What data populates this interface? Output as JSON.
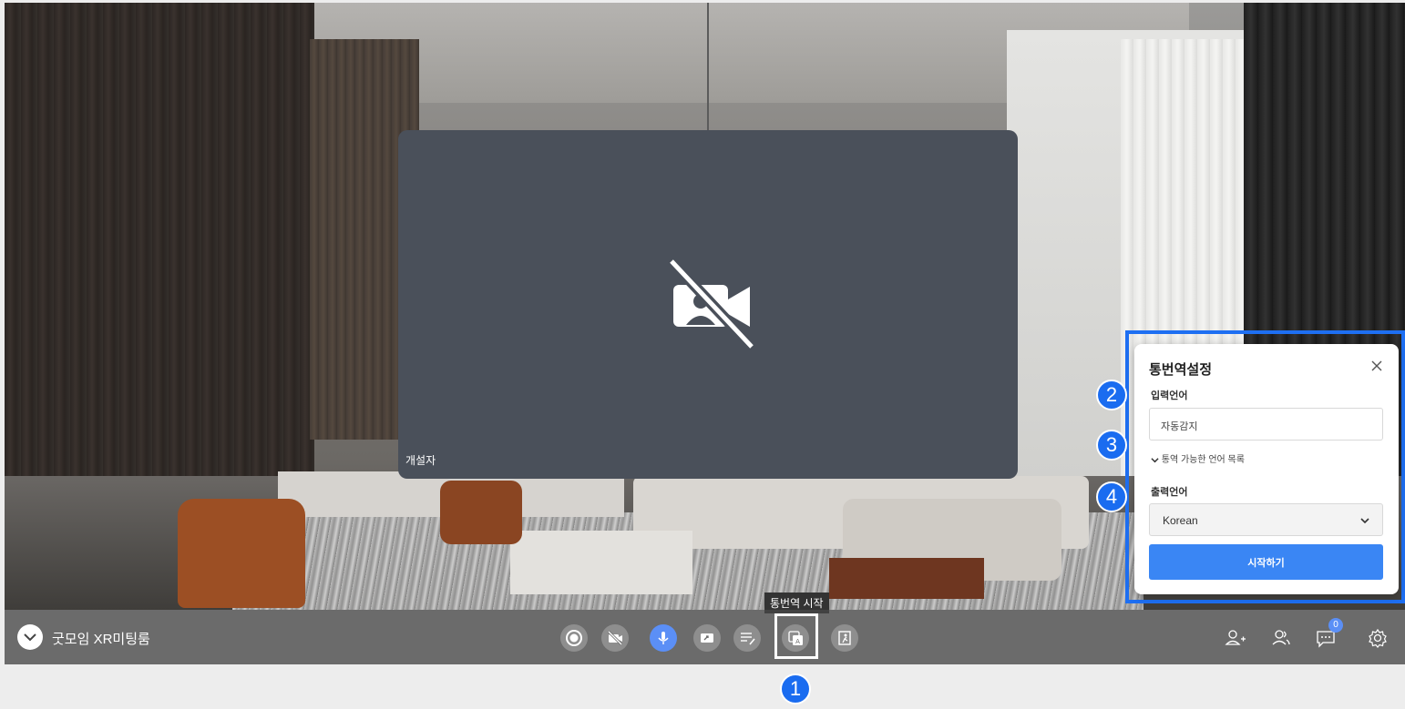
{
  "room": {
    "title": "굿모임 XR미팅룸"
  },
  "video_tile": {
    "host_label": "개설자",
    "icon": "camera-off-icon"
  },
  "toolbar": {
    "controls": [
      {
        "name": "record",
        "icon": "record-icon"
      },
      {
        "name": "camera-toggle",
        "icon": "camera-off-icon"
      },
      {
        "name": "mic",
        "icon": "microphone-icon"
      },
      {
        "name": "screen-share",
        "icon": "screen-share-icon"
      },
      {
        "name": "whiteboard",
        "icon": "whiteboard-icon"
      },
      {
        "name": "interpretation",
        "icon": "translate-icon"
      },
      {
        "name": "leave",
        "icon": "exit-icon"
      }
    ],
    "tooltip": "통번역 시작",
    "right_icons": [
      "invite-user-icon",
      "participants-icon",
      "chat-icon",
      "settings-icon"
    ],
    "chat_badge": "0"
  },
  "callouts": [
    "1",
    "2",
    "3",
    "4"
  ],
  "interp_panel": {
    "title": "통번역설정",
    "input_label": "입력언어",
    "input_value": "자동감지",
    "lang_list_toggle": "통역 가능한 언어 목록",
    "output_label": "출력언어",
    "output_value": "Korean",
    "start_label": "시작하기"
  },
  "colors": {
    "accent": "#3a86f4",
    "highlight_border": "#1e6ff2",
    "callout": "#1a6cf0",
    "video_tile": "#4a505a"
  }
}
